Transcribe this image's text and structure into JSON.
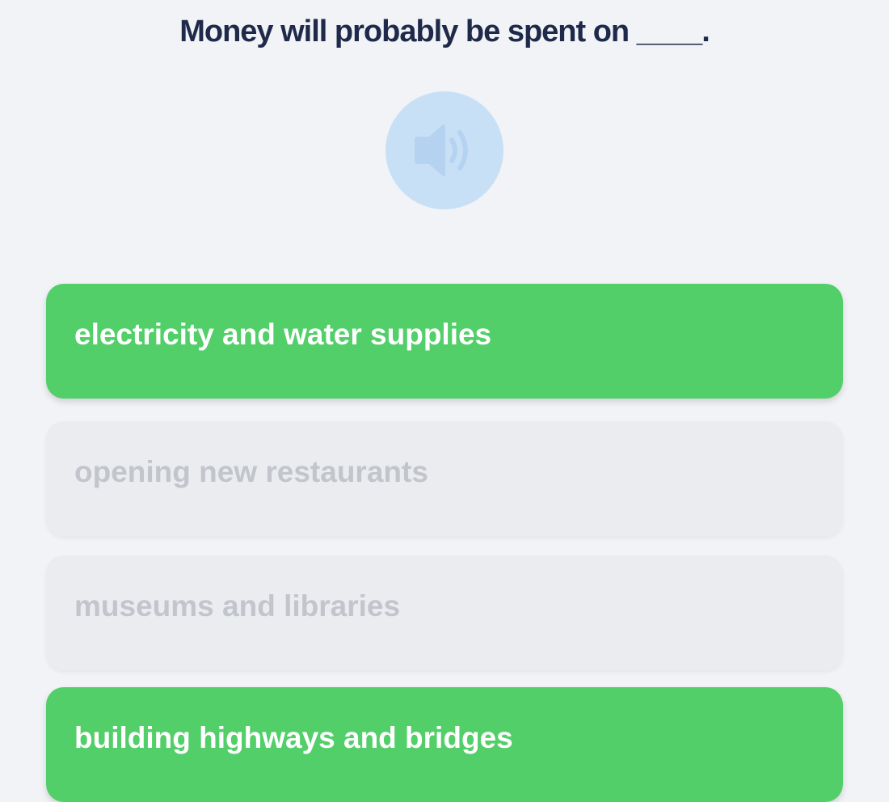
{
  "question": {
    "text": "Money will probably be spent on ____."
  },
  "audio_button": {
    "icon": "speaker-icon",
    "color": "#c8e0f6"
  },
  "colors": {
    "correct": "#52cf69",
    "faded": "#ebecef",
    "question_text": "#1f2a4a"
  },
  "options": [
    {
      "label": "electricity and water supplies",
      "state": "correct"
    },
    {
      "label": "opening new restaurants",
      "state": "faded"
    },
    {
      "label": "museums and libraries",
      "state": "faded"
    },
    {
      "label": "building highways and bridges",
      "state": "correct"
    }
  ]
}
